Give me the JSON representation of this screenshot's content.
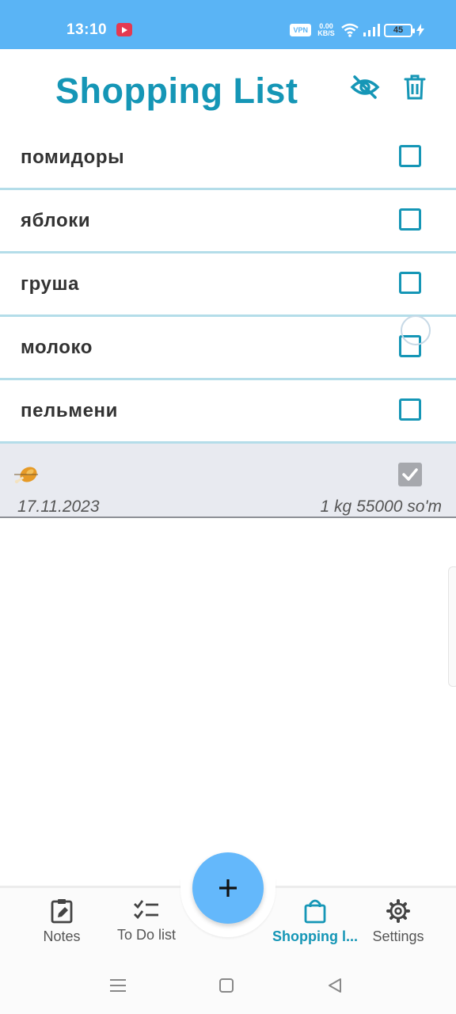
{
  "status_bar": {
    "time": "13:10",
    "vpn": "VPN",
    "net_speed_value": "0.00",
    "net_speed_unit": "KB/S",
    "battery": "45",
    "color": "#5ab4f5"
  },
  "header": {
    "title": "Shopping List",
    "icons": [
      "eye-off-icon",
      "trash-icon"
    ],
    "accent_color": "#1596b6"
  },
  "items": [
    {
      "label": "помидоры",
      "checked": false
    },
    {
      "label": "яблоки",
      "checked": false
    },
    {
      "label": "груша",
      "checked": false
    },
    {
      "label": "молоко",
      "checked": false
    },
    {
      "label": "пельмени",
      "checked": false
    }
  ],
  "completed_item": {
    "icon": "chicken-leg-emoji",
    "checked": true,
    "date": "17.11.2023",
    "details": "1 kg 55000 so'm"
  },
  "bottom_nav": {
    "items": [
      {
        "label": "Notes",
        "icon": "notes-icon",
        "active": false
      },
      {
        "label": "To Do list",
        "icon": "todo-list-icon",
        "active": false
      },
      {
        "label": "Shopping l...",
        "icon": "shopping-bag-icon",
        "active": true
      },
      {
        "label": "Settings",
        "icon": "gear-icon",
        "active": false
      }
    ],
    "fab_icon": "plus-icon",
    "fab_color": "#64b8fb"
  },
  "system_nav": {
    "icons": [
      "menu-icon",
      "home-icon",
      "back-icon"
    ]
  }
}
